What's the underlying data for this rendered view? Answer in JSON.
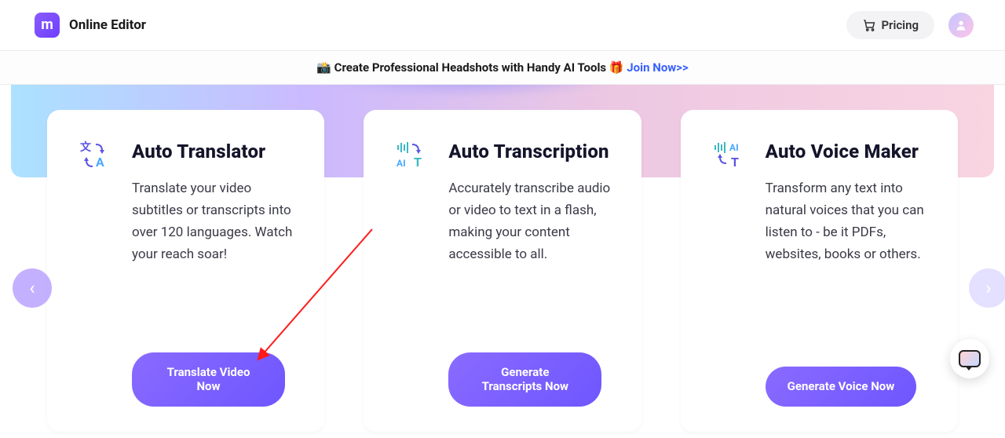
{
  "header": {
    "logo_letter": "m",
    "title": "Online Editor",
    "pricing_label": "Pricing"
  },
  "banner": {
    "emoji_left": "📸",
    "text": "Create Professional Headshots with Handy AI Tools",
    "emoji_right": "🎁",
    "link": "Join Now>>"
  },
  "cards": [
    {
      "title": "Auto Translator",
      "desc": "Translate your video subtitles or transcripts into over 120 languages. Watch your reach soar!",
      "cta": "Translate Video Now"
    },
    {
      "title": "Auto Transcription",
      "desc": "Accurately transcribe audio or video to text in a flash, making your content accessible to all.",
      "cta": "Generate Transcripts Now"
    },
    {
      "title": "Auto Voice Maker",
      "desc": "Transform any text into natural voices that you can listen to - be it PDFs, websites, books or others.",
      "cta": "Generate Voice Now"
    }
  ],
  "nav": {
    "left": "‹",
    "right": "›"
  }
}
